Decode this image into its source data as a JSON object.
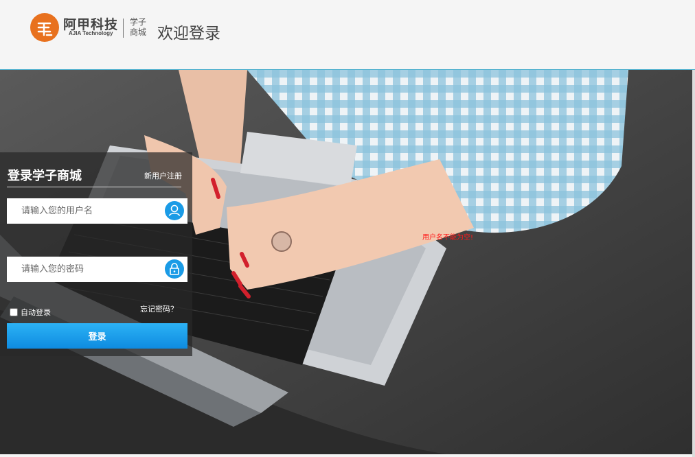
{
  "header": {
    "brand_name": "阿甲科技",
    "brand_sub": "AJIA Technology",
    "store_tag": "学子商城",
    "welcome": "欢迎登录"
  },
  "login": {
    "title": "登录学子商城",
    "register_link": "新用户注册",
    "username_placeholder": "请输入您的用户名",
    "password_placeholder": "请输入您的密码",
    "remember_label": "自动登录",
    "remember_checked": false,
    "forgot_link": "忘记密码？",
    "submit_label": "登录",
    "error_message": "用户名不能为空!"
  },
  "colors": {
    "brand_orange": "#e8711e",
    "accent_blue": "#1a9be6",
    "error_red": "#ff1a1a",
    "header_border": "#2ea2c6"
  },
  "icons": {
    "logo": "ajia-logo-icon",
    "username": "user-icon",
    "password": "lock-icon"
  }
}
